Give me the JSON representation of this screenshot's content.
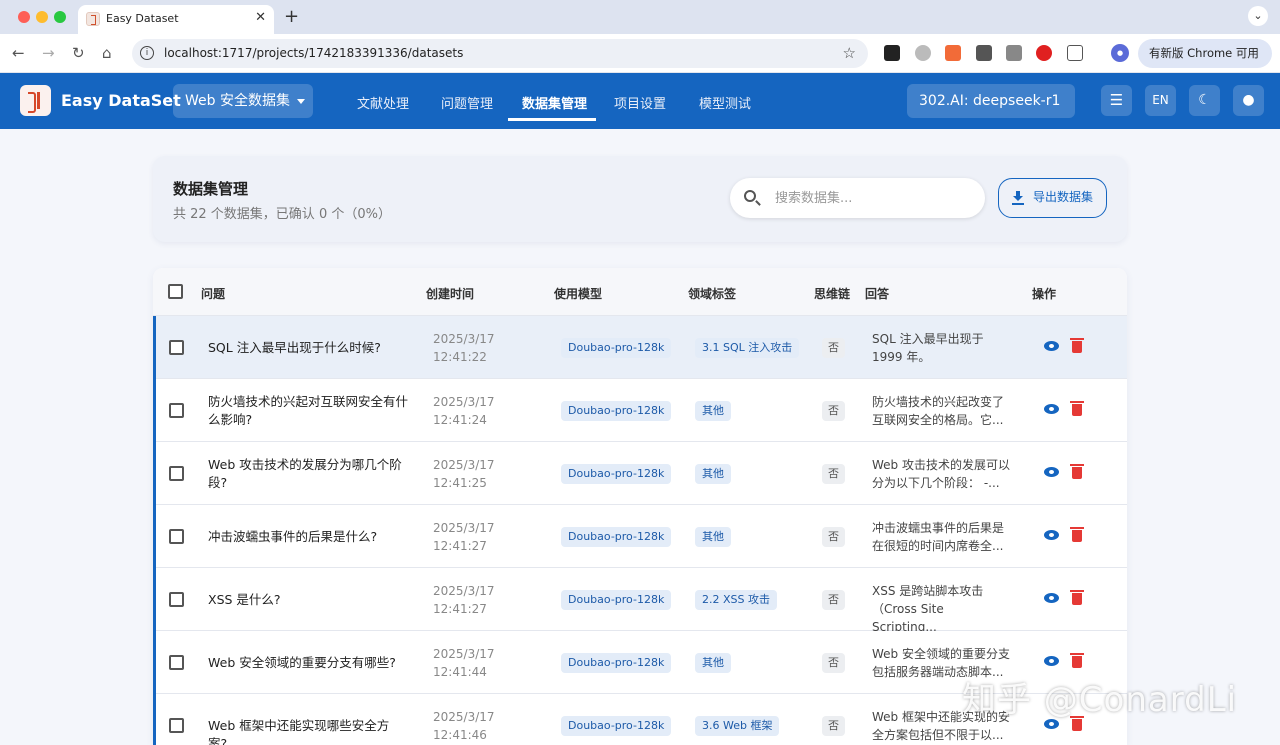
{
  "browser": {
    "tab_title": "Easy Dataset",
    "url": "localhost:1717/projects/1742183391336/datasets",
    "update_button": "有新版 Chrome 可用"
  },
  "header": {
    "brand": "Easy DataSet",
    "project": "Web 安全数据集",
    "nav": [
      "文献处理",
      "问题管理",
      "数据集管理",
      "项目设置",
      "模型测试"
    ],
    "active_nav": "数据集管理",
    "model": "302.AI: deepseek-r1",
    "lang_button": "EN",
    "accent_color": "#1565c0"
  },
  "summary": {
    "title": "数据集管理",
    "subtitle": "共 22 个数据集，已确认 0 个（0%）",
    "search_placeholder": "搜索数据集...",
    "export_label": "导出数据集"
  },
  "table": {
    "columns": [
      "问题",
      "创建时间",
      "使用模型",
      "领域标签",
      "思维链",
      "回答",
      "操作"
    ],
    "rows": [
      {
        "question": "SQL 注入最早出现于什么时候?",
        "date": "2025/3/17",
        "time": "12:41:22",
        "model": "Doubao-pro-128k",
        "tag": "3.1 SQL 注入攻击",
        "cot": "否",
        "answer": "SQL 注入最早出现于 1999 年。"
      },
      {
        "question": "防火墙技术的兴起对互联网安全有什么影响?",
        "date": "2025/3/17",
        "time": "12:41:24",
        "model": "Doubao-pro-128k",
        "tag": "其他",
        "cot": "否",
        "answer": "防火墙技术的兴起改变了互联网安全的格局。它..."
      },
      {
        "question": "Web 攻击技术的发展分为哪几个阶段?",
        "date": "2025/3/17",
        "time": "12:41:25",
        "model": "Doubao-pro-128k",
        "tag": "其他",
        "cot": "否",
        "answer": "Web 攻击技术的发展可以分为以下几个阶段： -..."
      },
      {
        "question": "冲击波蠕虫事件的后果是什么?",
        "date": "2025/3/17",
        "time": "12:41:27",
        "model": "Doubao-pro-128k",
        "tag": "其他",
        "cot": "否",
        "answer": "冲击波蠕虫事件的后果是在很短的时间内席卷全..."
      },
      {
        "question": "XSS 是什么?",
        "date": "2025/3/17",
        "time": "12:41:27",
        "model": "Doubao-pro-128k",
        "tag": "2.2 XSS 攻击",
        "cot": "否",
        "answer": "XSS 是跨站脚本攻击（Cross Site Scripting..."
      },
      {
        "question": "Web 安全领域的重要分支有哪些?",
        "date": "2025/3/17",
        "time": "12:41:44",
        "model": "Doubao-pro-128k",
        "tag": "其他",
        "cot": "否",
        "answer": "Web 安全领域的重要分支包括服务器端动态脚本..."
      },
      {
        "question": "Web 框架中还能实现哪些安全方案?",
        "date": "2025/3/17",
        "time": "12:41:46",
        "model": "Doubao-pro-128k",
        "tag": "3.6 Web 框架",
        "cot": "否",
        "answer": "Web 框架中还能实现的安全方案包括但不限于以..."
      }
    ]
  },
  "watermark": "知乎 @ConardLi"
}
